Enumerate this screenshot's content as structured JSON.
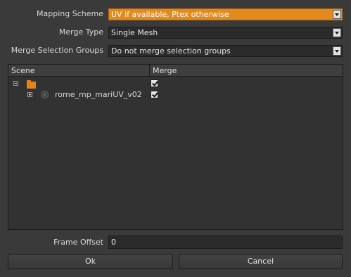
{
  "form": {
    "mapping_scheme": {
      "label": "Mapping Scheme",
      "value": "UV if available, Ptex otherwise"
    },
    "merge_type": {
      "label": "Merge Type",
      "value": "Single Mesh"
    },
    "merge_selection_groups": {
      "label": "Merge Selection Groups",
      "value": "Do not merge selection groups"
    },
    "frame_offset": {
      "label": "Frame Offset",
      "value": "0"
    }
  },
  "tree": {
    "columns": [
      "Scene",
      "Merge"
    ],
    "rows": [
      {
        "name": "",
        "icon": "folder-icon",
        "expanded": true,
        "merge": true
      },
      {
        "name": "rome_mp_mariUV_v02",
        "icon": "object-icon",
        "expanded": false,
        "merge": true
      }
    ]
  },
  "buttons": {
    "ok": "Ok",
    "cancel": "Cancel"
  },
  "colors": {
    "accent": "#e38a1f",
    "background": "#3a3a3a",
    "field": "#2b2b2b"
  }
}
